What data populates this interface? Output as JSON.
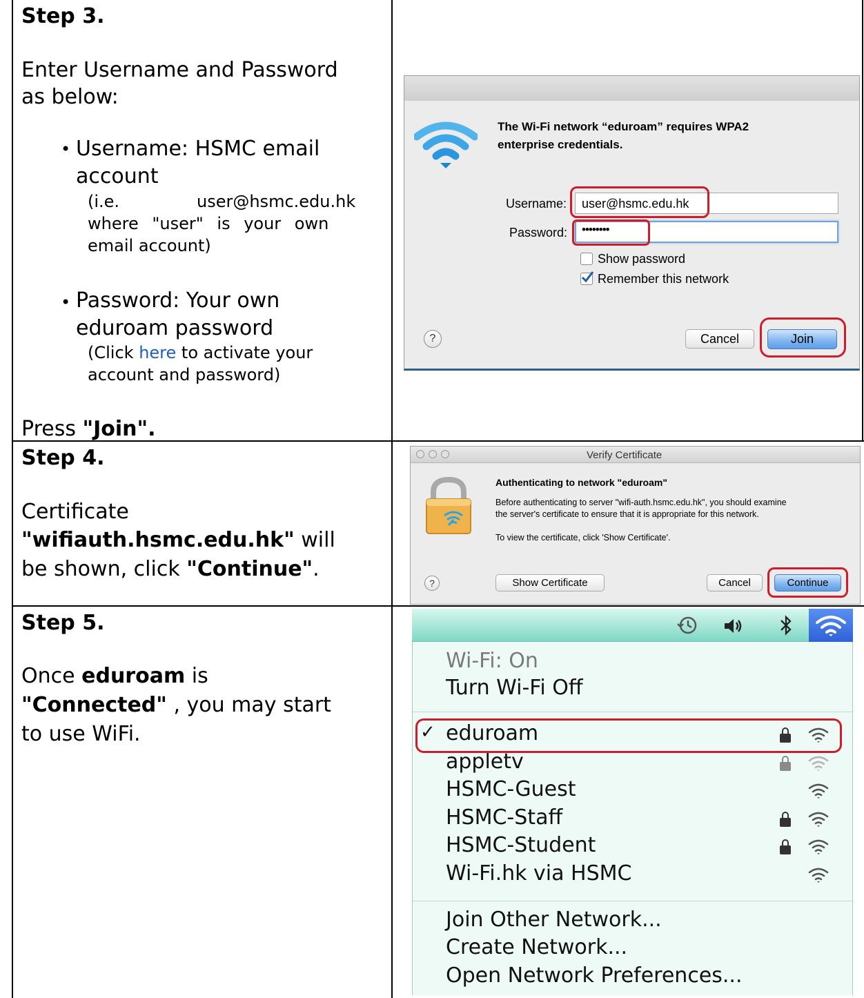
{
  "step3": {
    "heading": "Step 3.",
    "intro_line1": "Enter Username and Password",
    "intro_line2": "as below:",
    "bullet1_line1": "Username: HSMC email",
    "bullet1_line2": "account",
    "bullet1_note1": "(i.e.",
    "bullet1_note1b": "user@hsmc.edu.hk",
    "bullet1_note2": "where \"user\" is your own",
    "bullet1_note3": "email account)",
    "bullet2_line1": "Password: Your own",
    "bullet2_line2": "eduroam password",
    "bullet2_note1_pre": "(Click ",
    "bullet2_note1_link": "here",
    "bullet2_note1_post": " to activate your",
    "bullet2_note2": "account and password)",
    "press_pre": "Press ",
    "press_bold": "\"Join\".",
    "bullet_glyph": "•",
    "dialog": {
      "message_line1": "The Wi-Fi network “eduroam” requires WPA2",
      "message_line2": "enterprise credentials.",
      "username_label": "Username:",
      "username_value": "user@hsmc.edu.hk",
      "password_label": "Password:",
      "password_value": "••••••••",
      "show_password": "Show password",
      "remember_network": "Remember this network",
      "help_label": "?",
      "cancel": "Cancel",
      "join": "Join"
    }
  },
  "step4": {
    "heading": "Step 4.",
    "line1": "Certificate",
    "line2_bold": "\"wifiauth.hsmc.edu.hk\"",
    "line2_post": " will",
    "line3_pre": "be shown, click ",
    "line3_bold": "\"Continue\"",
    "line3_post": ".",
    "dialog": {
      "title": "Verify Certificate",
      "heading": "Authenticating to network \"eduroam\"",
      "body_line1": "Before authenticating to server \"wifi-auth.hsmc.edu.hk\", you should examine",
      "body_line2": "the server's certificate to ensure that it is appropriate for this network.",
      "hint": "To view the certificate, click 'Show Certificate'.",
      "help_label": "?",
      "show_certificate": "Show Certificate",
      "cancel": "Cancel",
      "continue": "Continue"
    }
  },
  "step5": {
    "heading": "Step 5.",
    "line1_pre": "Once ",
    "line1_bold": "eduroam",
    "line1_post": " is",
    "line2_bold": "\"Connected\"",
    "line2_post": " , you may start",
    "line3": "to use WiFi.",
    "menu": {
      "status": "Wi-Fi: On",
      "toggle": "Turn Wi-Fi Off",
      "checkmark": "✓",
      "networks": [
        {
          "name": "eduroam",
          "locked": true,
          "connected": true
        },
        {
          "name": "appletv",
          "locked": true,
          "connected": false
        },
        {
          "name": "HSMC-Guest",
          "locked": false,
          "connected": false
        },
        {
          "name": "HSMC-Staff",
          "locked": true,
          "connected": false
        },
        {
          "name": "HSMC-Student",
          "locked": true,
          "connected": false
        },
        {
          "name": "Wi-Fi.hk via HSMC",
          "locked": false,
          "connected": false
        }
      ],
      "join_other": "Join Other Network...",
      "create": "Create Network...",
      "open_prefs": "Open Network Preferences..."
    }
  },
  "colors": {
    "link": "#1f5fbf",
    "highlight_red": "#d01c2a",
    "wifi_blue": "#2aa4e8",
    "menubar_teal": "#7fd8c5",
    "menu_bg": "#eefaf6"
  },
  "icons": [
    "wifi-icon",
    "lock-wifi-icon",
    "time-machine-icon",
    "volume-icon",
    "bluetooth-icon",
    "lock-icon"
  ]
}
